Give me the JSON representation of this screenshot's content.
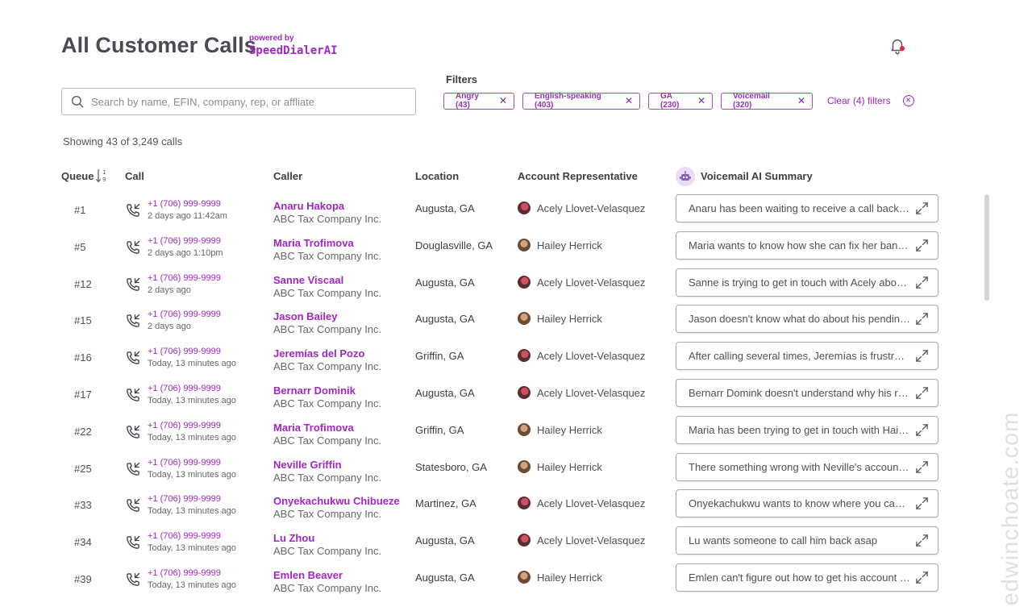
{
  "header": {
    "title": "All Customer Calls",
    "powered_by": "powered by",
    "brand": "SpeedDialerAI"
  },
  "search": {
    "placeholder": "Search by name, EFIN, company, rep, or affliate"
  },
  "filters": {
    "label": "Filters",
    "chips": [
      "Angry (43)",
      "English-speaking (403)",
      "GA (230)",
      "Voicemail (320)"
    ],
    "clear_label": "Clear (4) filters"
  },
  "showing": "Showing 43 of 3,249 calls",
  "columns": {
    "queue": "Queue",
    "call": "Call",
    "caller": "Caller",
    "location": "Location",
    "rep": "Account Representative",
    "summary": "Voicemail AI Summary"
  },
  "rows": [
    {
      "queue": "#1",
      "phone": "+1 (706) 999-9999",
      "time": "2 days ago 11:42am",
      "name": "Anaru Hakopa",
      "company": "ABC Tax Company Inc.",
      "location": "Augusta, GA",
      "rep": "Acely Llovet-Velasquez",
      "summary": "Anaru has been waiting to receive a call back for days"
    },
    {
      "queue": "#5",
      "phone": "+1 (706) 999-9999",
      "time": "2 days ago 1:10pm",
      "name": "Maria Trofimova",
      "company": "ABC Tax Company Inc.",
      "location": "Douglasville, GA",
      "rep": "Hailey Herrick",
      "summary": "Maria wants to know how she can fix her bank information"
    },
    {
      "queue": "#12",
      "phone": "+1 (706) 999-9999",
      "time": "2 days ago",
      "name": "Sanne Viscaal",
      "company": "ABC Tax Company Inc.",
      "location": "Augusta, GA",
      "rep": "Acely Llovet-Velasquez",
      "summary": "Sanne is trying to get in touch with Acely about her account"
    },
    {
      "queue": "#15",
      "phone": "+1 (706) 999-9999",
      "time": "2 days ago",
      "name": "Jason Bailey",
      "company": "ABC Tax Company Inc.",
      "location": "Augusta, GA",
      "rep": "Hailey Herrick",
      "summary": "Jason doesn't know what do about his pending return"
    },
    {
      "queue": "#16",
      "phone": "+1 (706) 999-9999",
      "time": "Today, 13 minutes ago",
      "name": "Jeremías del Pozo",
      "company": "ABC Tax Company Inc.",
      "location": "Griffin, GA",
      "rep": "Acely Llovet-Velasquez",
      "summary": "After calling several times, Jeremías is frustrated"
    },
    {
      "queue": "#17",
      "phone": "+1 (706) 999-9999",
      "time": "Today, 13 minutes ago",
      "name": "Bernarr Dominik",
      "company": "ABC Tax Company Inc.",
      "location": "Augusta, GA",
      "rep": "Acely Llovet-Velasquez",
      "summary": "Bernarr Domink doesn't understand why his refund is late"
    },
    {
      "queue": "#22",
      "phone": "+1 (706) 999-9999",
      "time": "Today, 13 minutes ago",
      "name": "Maria Trofimova",
      "company": "ABC Tax Company Inc.",
      "location": "Griffin, GA",
      "rep": "Hailey Herrick",
      "summary": "Maria has been trying to get in touch with Hailey all week"
    },
    {
      "queue": "#25",
      "phone": "+1 (706) 999-9999",
      "time": "Today, 13 minutes ago",
      "name": "Neville Griffin",
      "company": "ABC Tax Company Inc.",
      "location": "Statesboro, GA",
      "rep": "Hailey Herrick",
      "summary": "There something wrong with Neville's account settings"
    },
    {
      "queue": "#33",
      "phone": "+1 (706) 999-9999",
      "time": "Today, 13 minutes ago",
      "name": "Onyekachukwu Chibueze",
      "company": "ABC Tax Company Inc.",
      "location": "Martinez, GA",
      "rep": "Acely Llovet-Velasquez",
      "summary": "Onyekachukwu wants to know where you can find the form"
    },
    {
      "queue": "#34",
      "phone": "+1 (706) 999-9999",
      "time": "Today, 13 minutes ago",
      "name": "Lu Zhou",
      "company": "ABC Tax Company Inc.",
      "location": "Augusta, GA",
      "rep": "Acely Llovet-Velasquez",
      "summary": "Lu wants someone to call him back asap"
    },
    {
      "queue": "#39",
      "phone": "+1 (706) 999-9999",
      "time": "Today, 13 minutes ago",
      "name": "Emlen Beaver",
      "company": "ABC Tax Company Inc.",
      "location": "Augusta, GA",
      "rep": "Hailey Herrick",
      "summary": "Emlen can't figure out how to get his account unlocked"
    }
  ],
  "watermark": "edwinchoate.com",
  "colors": {
    "accent": "#a127c4",
    "notification_dot": "#e8263b",
    "text": "#3d3d45"
  },
  "icons": {
    "bell": "bell-icon",
    "search": "search-icon",
    "sort": "sort-ascending-icon",
    "call": "incoming-call-icon",
    "expand": "expand-icon",
    "clear": "close-circle-icon",
    "ai": "robot-icon"
  }
}
